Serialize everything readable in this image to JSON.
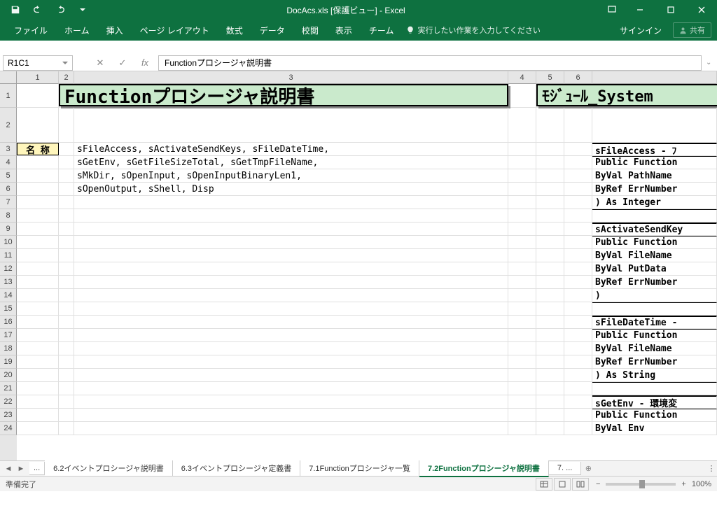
{
  "titlebar": {
    "app_title": "DocAcs.xls [保護ビュー] - Excel"
  },
  "ribbon": {
    "tabs": [
      "ファイル",
      "ホーム",
      "挿入",
      "ページ レイアウト",
      "数式",
      "データ",
      "校閲",
      "表示",
      "チーム"
    ],
    "tell_me": "実行したい作業を入力してください",
    "signin": "サインイン",
    "share": "共有"
  },
  "namebox": {
    "ref": "R1C1"
  },
  "formula": {
    "text": "Functionプロシージャ説明書"
  },
  "cols": [
    "1",
    "2",
    "3",
    "4",
    "5",
    "6"
  ],
  "rows": [
    "1",
    "2",
    "3",
    "4",
    "5",
    "6",
    "7",
    "8",
    "9",
    "10",
    "11",
    "12",
    "13",
    "14",
    "15",
    "16",
    "17",
    "18",
    "19",
    "20",
    "21",
    "22",
    "23",
    "24"
  ],
  "cells": {
    "title": "Functionプロシージャ説明書",
    "module": "ﾓｼﾞｭｰﾙ_System",
    "label_name": "名 称",
    "line3": "sFileAccess, sActivateSendKeys, sFileDateTime,",
    "line4": "sGetEnv, sGetFileSizeTotal, sGetTmpFileName,",
    "line5": "sMkDir, sOpenInput, sOpenInputBinaryLen1,",
    "line6": "sOpenOutput, sShell, Disp",
    "r3": "sFileAccess - ﾌ",
    "r4": "Public Function",
    "r5": "  ByVal PathName",
    "r6": "  ByRef ErrNumber",
    "r7": ") As Integer",
    "r9": "sActivateSendKey",
    "r10": "Public Function",
    "r11": "  ByVal FileName",
    "r12": "  ByVal PutData",
    "r13": "  ByRef ErrNumber",
    "r14": ")",
    "r16": "sFileDateTime -",
    "r17": "Public Function",
    "r18": "  ByVal FileName",
    "r19": "  ByRef ErrNumber",
    "r20": ") As String",
    "r22": "sGetEnv - 環境変",
    "r23": "Public Function",
    "r24": "  ByVal Env"
  },
  "sheets": {
    "ellipsis": "...",
    "tabs": [
      "6.2イベントプロシージャ説明書",
      "6.3イベントプロシージャ定義書",
      "7.1Functionプロシージャ一覧",
      "7.2Functionプロシージャ説明書",
      "7. ..."
    ],
    "active_index": 3,
    "more": "..."
  },
  "statusbar": {
    "ready": "準備完了",
    "zoom": "100%"
  }
}
